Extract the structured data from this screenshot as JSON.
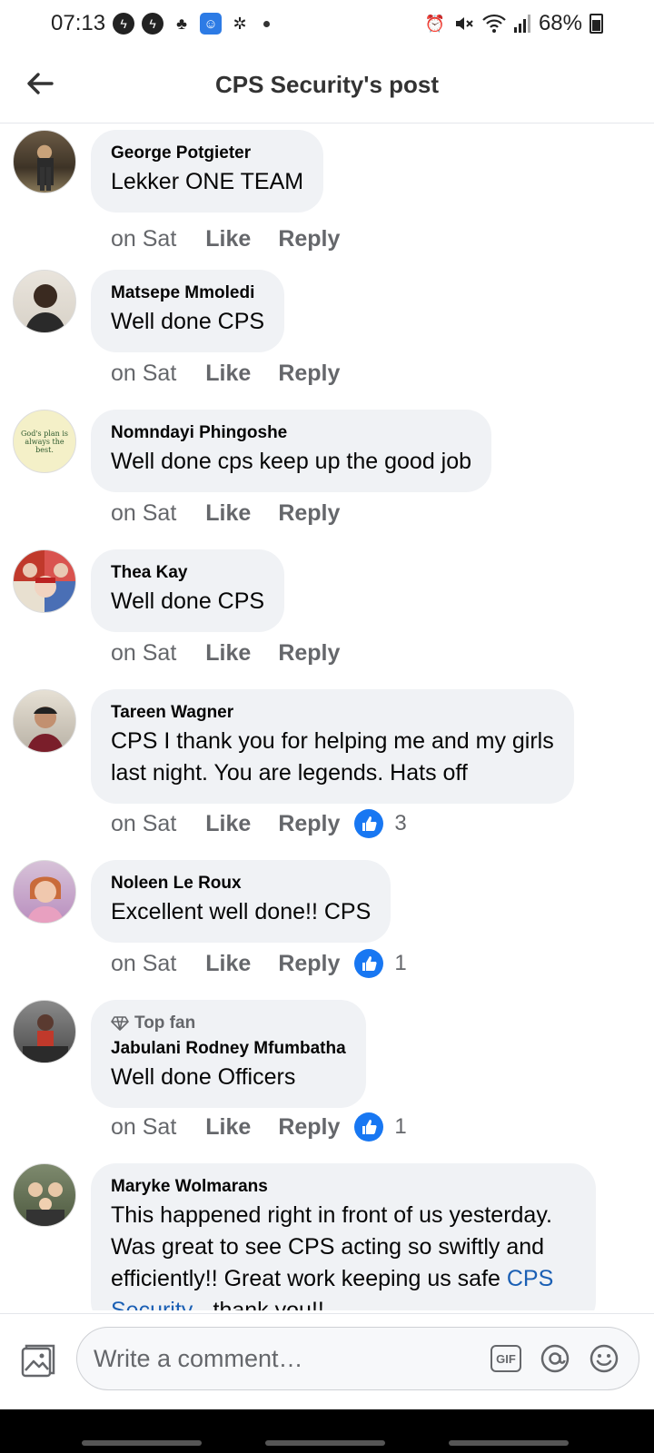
{
  "status_bar": {
    "time": "07:13",
    "battery": "68%",
    "icons": [
      "facebook-messenger-icon",
      "facebook-messenger-icon",
      "shop-icon",
      "app-icon",
      "settings-dots-icon",
      "alarm-icon",
      "mute-icon",
      "wifi-icon",
      "signal-icon",
      "battery-icon"
    ]
  },
  "header": {
    "title": "CPS Security's post",
    "back_icon": "back-arrow-icon"
  },
  "comments": [
    {
      "name": "George Potgieter",
      "text": "Lekker ONE  TEAM",
      "time": "on Sat",
      "like": "Like",
      "reply": "Reply",
      "reactions": null
    },
    {
      "name": "Matsepe Mmoledi",
      "text": "Well done CPS",
      "time": "on Sat",
      "like": "Like",
      "reply": "Reply",
      "reactions": null
    },
    {
      "name": "Nomndayi Phingoshe",
      "text": "Well done cps keep up the good job",
      "time": "on Sat",
      "like": "Like",
      "reply": "Reply",
      "reactions": null,
      "avatar_text": "God's plan is always the best."
    },
    {
      "name": "Thea Kay",
      "text": "Well done CPS",
      "time": "on Sat",
      "like": "Like",
      "reply": "Reply",
      "reactions": null
    },
    {
      "name": "Tareen Wagner",
      "text_line1": "CPS I thank you for helping me and my girls",
      "text_line2": "last night. You are legends. Hats off",
      "time": "on Sat",
      "like": "Like",
      "reply": "Reply",
      "reactions": "3"
    },
    {
      "name": "Noleen Le Roux",
      "text": "Excellent well done!! CPS",
      "time": "on Sat",
      "like": "Like",
      "reply": "Reply",
      "reactions": "1"
    },
    {
      "badge": "Top fan",
      "name": "Jabulani Rodney Mfumbatha",
      "text": "Well done Officers",
      "time": "on Sat",
      "like": "Like",
      "reply": "Reply",
      "reactions": "1"
    },
    {
      "name": "Maryke Wolmarans",
      "text_line1": "This happened right in front of us yesterday.",
      "text_line2": "Was great to see CPS acting so swiftly and",
      "text_line3_pre": "efficiently!! Great work keeping us safe ",
      "text_line3_link": "CPS",
      "text_line4_link": "Security",
      "text_line4_post": " - thank you!!"
    }
  ],
  "composer": {
    "placeholder": "Write a comment…",
    "gif_label": "GIF"
  },
  "colors": {
    "like_blue": "#1877f2",
    "link_blue": "#1a5fb4",
    "bubble_bg": "#f0f2f5",
    "secondary_text": "#65676b"
  }
}
